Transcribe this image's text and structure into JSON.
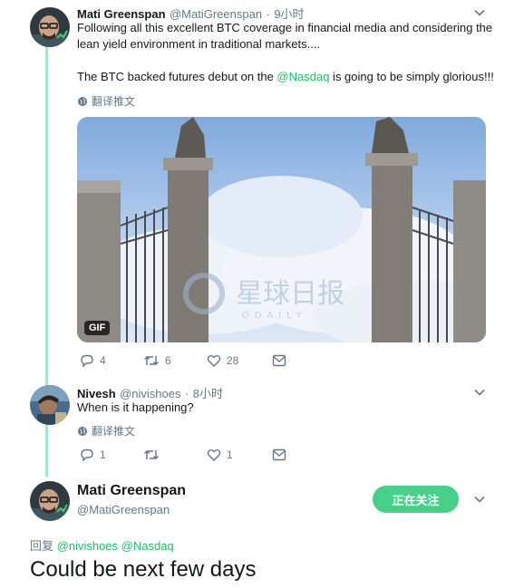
{
  "tweet1": {
    "name": "Mati Greenspan",
    "handle": "@MatiGreenspan",
    "time": "9小时",
    "text_line1": "Following all this excellent BTC coverage in financial media and considering the",
    "text_line2": "lean yield environment in traditional markets....",
    "text_para2_before": "The BTC backed futures debut on the ",
    "text_para2_mention": "@Nasdaq",
    "text_para2_after": " is going to be simply glorious!!!",
    "translate": "翻译推文",
    "media_badge": "GIF",
    "watermark_cn": "星球日报",
    "watermark_en": "ODAILY",
    "replies": "4",
    "retweets": "6",
    "likes": "28"
  },
  "tweet2": {
    "name": "Nivesh",
    "handle": "@nivishoes",
    "time": "8小时",
    "text": "When is it happening?",
    "translate": "翻译推文",
    "replies": "1",
    "retweets": "",
    "likes": "1"
  },
  "main_tweet": {
    "name": "Mati Greenspan",
    "handle": "@MatiGreenspan",
    "follow_label": "正在关注",
    "reply_prefix": "回复",
    "reply_mentions": "@nivishoes @Nasdaq",
    "text": "Could be next few days"
  },
  "colors": {
    "accent": "#17bf63",
    "thread_line": "#a8e6c9",
    "follow_button": "#46d08a",
    "secondary_text": "#657786"
  }
}
